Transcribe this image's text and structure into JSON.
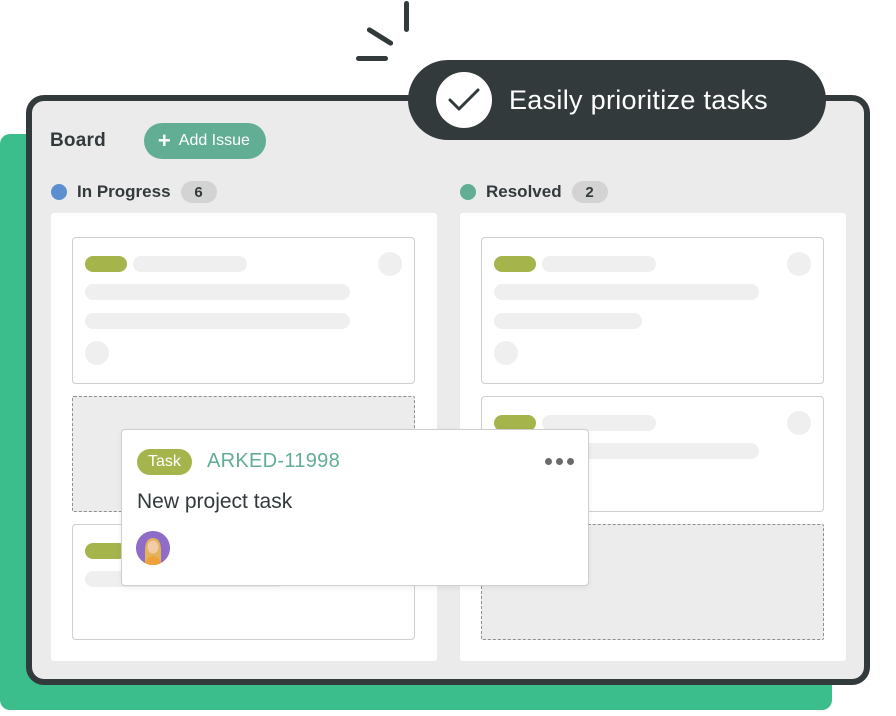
{
  "board": {
    "title": "Board",
    "add_issue_label": "Add Issue"
  },
  "columns": [
    {
      "name": "In Progress",
      "count": "6",
      "dot_color": "#5b8fcf"
    },
    {
      "name": "Resolved",
      "count": "2",
      "dot_color": "#62ae94"
    }
  ],
  "badge": {
    "text": "Easily prioritize tasks",
    "icon": "checkmark-icon"
  },
  "task_card": {
    "tag": "Task",
    "key": "ARKED-11998",
    "title": "New project task",
    "menu_icon": "more-horizontal-icon",
    "avatar_icon": "user-avatar"
  },
  "colors": {
    "accent_green": "#3bbd8c",
    "button_green": "#62ae94",
    "tag_olive": "#a6b44c",
    "dark": "#333a3c"
  }
}
